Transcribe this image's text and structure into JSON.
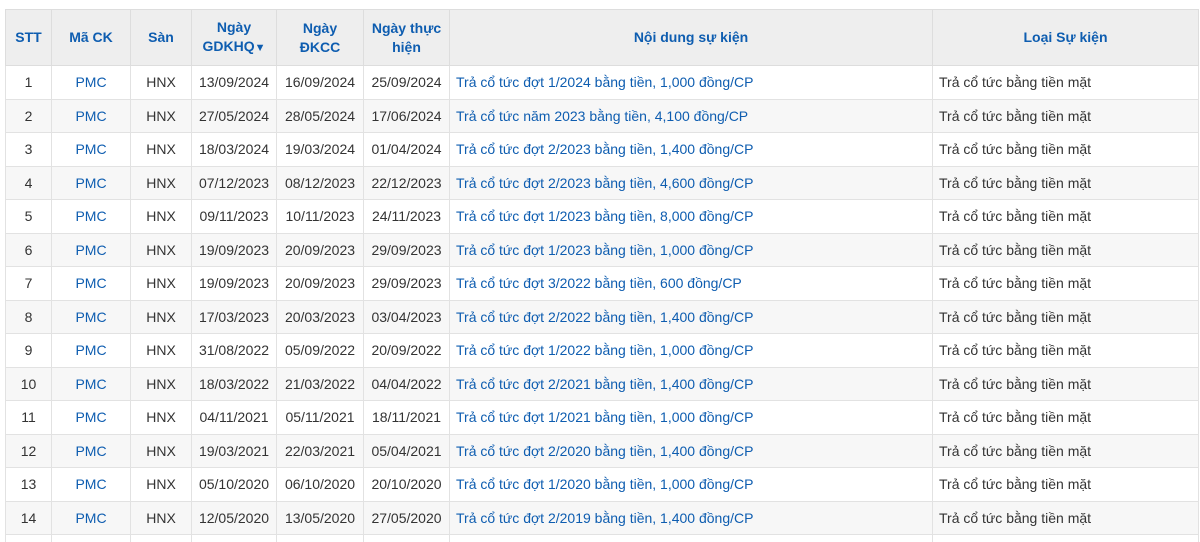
{
  "columns": {
    "stt": "STT",
    "ma_ck": "Mã CK",
    "san": "Sàn",
    "ngay_gdkhq_1": "Ngày",
    "ngay_gdkhq_2": "GDKHQ",
    "sort_glyph": "▼",
    "ngay_dkcc_1": "Ngày",
    "ngay_dkcc_2": "ĐKCC",
    "ngay_thuc_hien_1": "Ngày thực",
    "ngay_thuc_hien_2": "hiện",
    "noi_dung": "Nội dung sự kiện",
    "loai": "Loại Sự kiện"
  },
  "rows": [
    {
      "stt": "1",
      "ma": "PMC",
      "san": "HNX",
      "gdkhq": "13/09/2024",
      "dkcc": "16/09/2024",
      "thuc_hien": "25/09/2024",
      "noi_dung": "Trả cổ tức đợt 1/2024 bằng tiền, 1,000 đồng/CP",
      "loai": "Trả cổ tức bằng tiền mặt"
    },
    {
      "stt": "2",
      "ma": "PMC",
      "san": "HNX",
      "gdkhq": "27/05/2024",
      "dkcc": "28/05/2024",
      "thuc_hien": "17/06/2024",
      "noi_dung": "Trả cổ tức năm 2023 bằng tiền, 4,100 đồng/CP",
      "loai": "Trả cổ tức bằng tiền mặt"
    },
    {
      "stt": "3",
      "ma": "PMC",
      "san": "HNX",
      "gdkhq": "18/03/2024",
      "dkcc": "19/03/2024",
      "thuc_hien": "01/04/2024",
      "noi_dung": "Trả cổ tức đợt 2/2023 bằng tiền, 1,400 đồng/CP",
      "loai": "Trả cổ tức bằng tiền mặt"
    },
    {
      "stt": "4",
      "ma": "PMC",
      "san": "HNX",
      "gdkhq": "07/12/2023",
      "dkcc": "08/12/2023",
      "thuc_hien": "22/12/2023",
      "noi_dung": "Trả cổ tức đợt 2/2023 bằng tiền, 4,600 đồng/CP",
      "loai": "Trả cổ tức bằng tiền mặt"
    },
    {
      "stt": "5",
      "ma": "PMC",
      "san": "HNX",
      "gdkhq": "09/11/2023",
      "dkcc": "10/11/2023",
      "thuc_hien": "24/11/2023",
      "noi_dung": "Trả cổ tức đợt 1/2023 bằng tiền, 8,000 đồng/CP",
      "loai": "Trả cổ tức bằng tiền mặt"
    },
    {
      "stt": "6",
      "ma": "PMC",
      "san": "HNX",
      "gdkhq": "19/09/2023",
      "dkcc": "20/09/2023",
      "thuc_hien": "29/09/2023",
      "noi_dung": "Trả cổ tức đợt 1/2023 bằng tiền, 1,000 đồng/CP",
      "loai": "Trả cổ tức bằng tiền mặt"
    },
    {
      "stt": "7",
      "ma": "PMC",
      "san": "HNX",
      "gdkhq": "19/09/2023",
      "dkcc": "20/09/2023",
      "thuc_hien": "29/09/2023",
      "noi_dung": "Trả cổ tức đợt 3/2022 bằng tiền, 600 đồng/CP",
      "loai": "Trả cổ tức bằng tiền mặt"
    },
    {
      "stt": "8",
      "ma": "PMC",
      "san": "HNX",
      "gdkhq": "17/03/2023",
      "dkcc": "20/03/2023",
      "thuc_hien": "03/04/2023",
      "noi_dung": "Trả cổ tức đợt 2/2022 bằng tiền, 1,400 đồng/CP",
      "loai": "Trả cổ tức bằng tiền mặt"
    },
    {
      "stt": "9",
      "ma": "PMC",
      "san": "HNX",
      "gdkhq": "31/08/2022",
      "dkcc": "05/09/2022",
      "thuc_hien": "20/09/2022",
      "noi_dung": "Trả cổ tức đợt 1/2022 bằng tiền, 1,000 đồng/CP",
      "loai": "Trả cổ tức bằng tiền mặt"
    },
    {
      "stt": "10",
      "ma": "PMC",
      "san": "HNX",
      "gdkhq": "18/03/2022",
      "dkcc": "21/03/2022",
      "thuc_hien": "04/04/2022",
      "noi_dung": "Trả cổ tức đợt 2/2021 bằng tiền, 1,400 đồng/CP",
      "loai": "Trả cổ tức bằng tiền mặt"
    },
    {
      "stt": "11",
      "ma": "PMC",
      "san": "HNX",
      "gdkhq": "04/11/2021",
      "dkcc": "05/11/2021",
      "thuc_hien": "18/11/2021",
      "noi_dung": "Trả cổ tức đợt 1/2021 bằng tiền, 1,000 đồng/CP",
      "loai": "Trả cổ tức bằng tiền mặt"
    },
    {
      "stt": "12",
      "ma": "PMC",
      "san": "HNX",
      "gdkhq": "19/03/2021",
      "dkcc": "22/03/2021",
      "thuc_hien": "05/04/2021",
      "noi_dung": "Trả cổ tức đợt 2/2020 bằng tiền, 1,400 đồng/CP",
      "loai": "Trả cổ tức bằng tiền mặt"
    },
    {
      "stt": "13",
      "ma": "PMC",
      "san": "HNX",
      "gdkhq": "05/10/2020",
      "dkcc": "06/10/2020",
      "thuc_hien": "20/10/2020",
      "noi_dung": "Trả cổ tức đợt 1/2020 bằng tiền, 1,000 đồng/CP",
      "loai": "Trả cổ tức bằng tiền mặt"
    },
    {
      "stt": "14",
      "ma": "PMC",
      "san": "HNX",
      "gdkhq": "12/05/2020",
      "dkcc": "13/05/2020",
      "thuc_hien": "27/05/2020",
      "noi_dung": "Trả cổ tức đợt 2/2019 bằng tiền, 1,400 đồng/CP",
      "loai": "Trả cổ tức bằng tiền mặt"
    },
    {
      "stt": "",
      "ma": "",
      "san": "",
      "gdkhq": "",
      "dkcc": "",
      "thuc_hien": "",
      "noi_dung": "",
      "loai": ""
    }
  ],
  "colors": {
    "header_text": "#0e5db0",
    "link_text": "#0e5db0",
    "header_bg": "#eeeeee",
    "row_alt_bg": "#f7f7f7"
  }
}
